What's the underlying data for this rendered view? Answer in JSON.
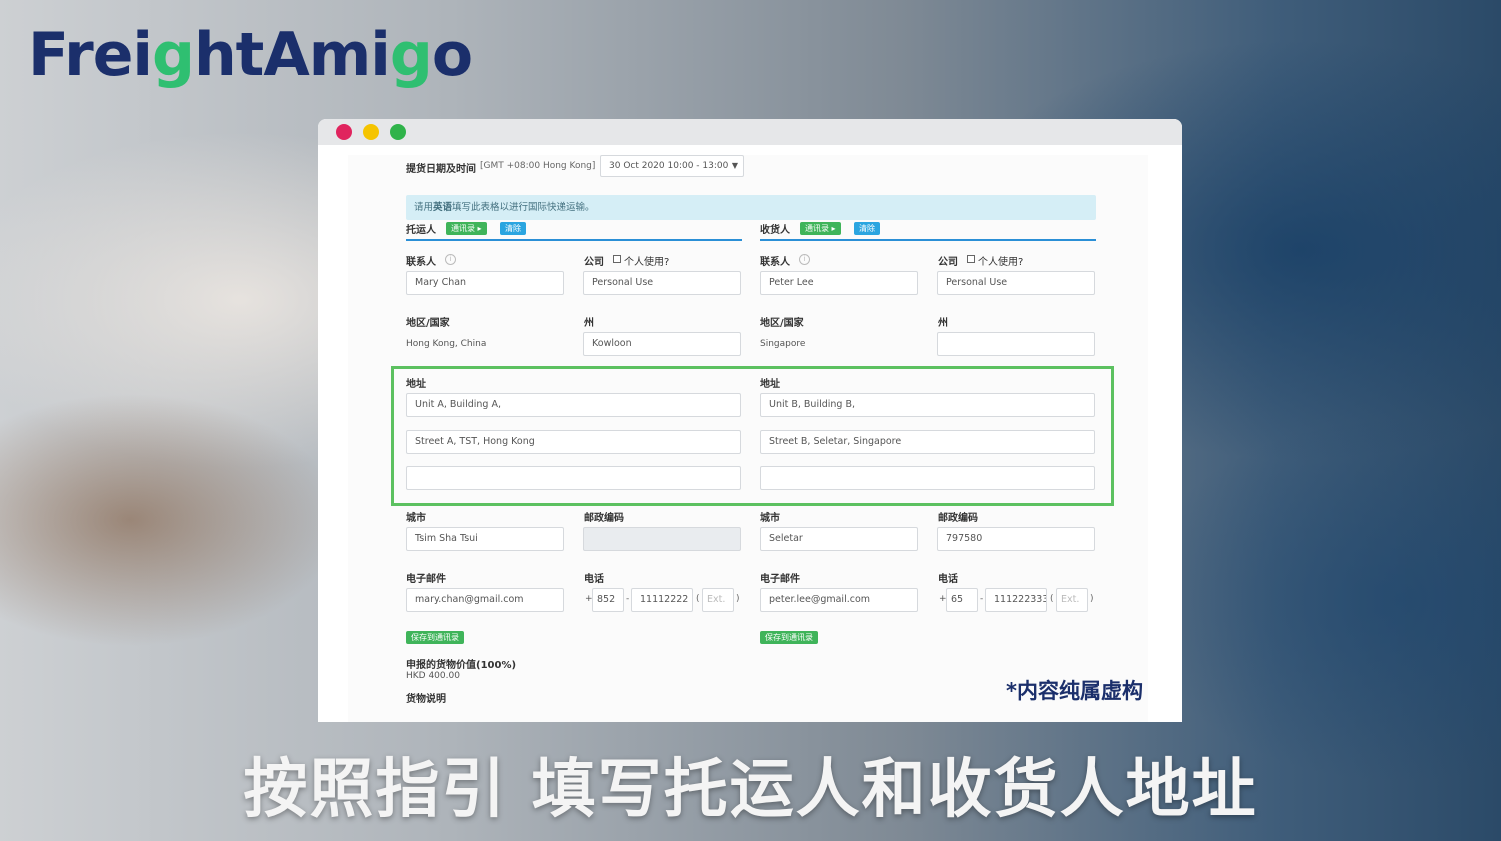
{
  "brand": {
    "logo_part1": "Frei",
    "logo_g1": "g",
    "logo_part2": "htAmi",
    "logo_g2": "g",
    "logo_part3": "o"
  },
  "colors": {
    "brand_navy": "#1b2f6b",
    "brand_green": "#2fbf71",
    "highlight_green": "#5cc160",
    "accent_blue": "#2a8fd6"
  },
  "form": {
    "pickup_label": "提货日期及时间",
    "timezone": "[GMT +08:00 Hong Kong]",
    "pickup_value": "30 Oct 2020 10:00 - 13:00",
    "notice_pre": "请用",
    "notice_bold": "英语",
    "notice_post": "填写此表格以进行国际快递运输。",
    "shipper": {
      "title": "托运人",
      "address_book_button": "通讯录 ▸",
      "clear_button": "清除",
      "contact_label": "联系人",
      "contact_value": "Mary Chan",
      "company_label": "公司",
      "personal_use_label": "个人使用?",
      "company_value": "Personal Use",
      "country_label": "地区/国家",
      "country_value": "Hong Kong, China",
      "state_label": "州",
      "state_value": "Kowloon",
      "address_label": "地址",
      "address_line1": "Unit A, Building A,",
      "address_line2": "Street A, TST, Hong Kong",
      "address_line3": "",
      "city_label": "城市",
      "city_value": "Tsim Sha Tsui",
      "postal_label": "邮政编码",
      "postal_value": "",
      "email_label": "电子邮件",
      "email_value": "mary.chan@gmail.com",
      "phone_label": "电话",
      "phone_plus": "+",
      "phone_country": "852",
      "phone_number": "11112222",
      "phone_ext_placeholder": "Ext.",
      "save_button": "保存到通讯录"
    },
    "consignee": {
      "title": "收货人",
      "address_book_button": "通讯录 ▸",
      "clear_button": "清除",
      "contact_label": "联系人",
      "contact_value": "Peter Lee",
      "company_label": "公司",
      "personal_use_label": "个人使用?",
      "company_value": "Personal Use",
      "country_label": "地区/国家",
      "country_value": "Singapore",
      "state_label": "州",
      "state_value": "",
      "address_label": "地址",
      "address_line1": "Unit B, Building B,",
      "address_line2": "Street B, Seletar, Singapore",
      "address_line3": "",
      "city_label": "城市",
      "city_value": "Seletar",
      "postal_label": "邮政编码",
      "postal_value": "797580",
      "email_label": "电子邮件",
      "email_value": "peter.lee@gmail.com",
      "phone_label": "电话",
      "phone_plus": "+",
      "phone_country": "65",
      "phone_number": "111222333",
      "phone_ext_placeholder": "Ext.",
      "save_button": "保存到通讯录"
    },
    "declared_value_label": "申报的货物价值(100%)",
    "declared_value": "HKD 400.00",
    "goods_description_label": "货物说明"
  },
  "disclaimer": "*内容纯属虚构",
  "caption": "按照指引 填写托运人和收货人地址"
}
